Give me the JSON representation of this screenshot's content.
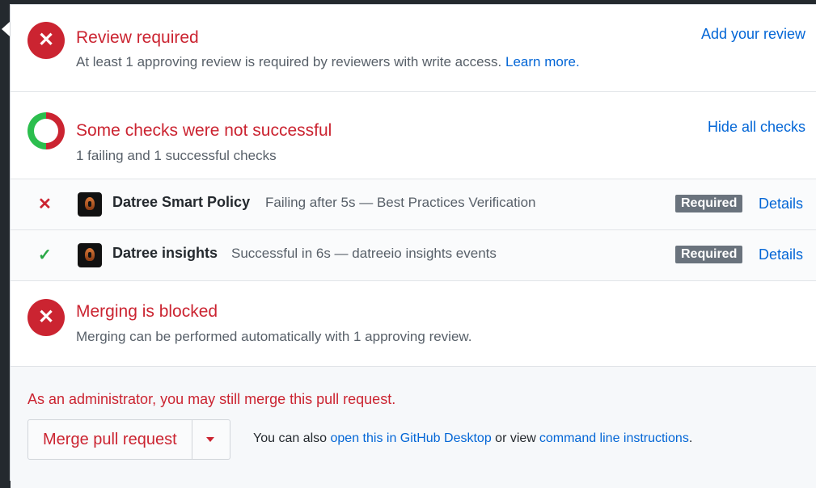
{
  "review": {
    "icon": "x-icon",
    "title": "Review required",
    "description": "At least 1 approving review is required by reviewers with write access.",
    "learn_more": "Learn more.",
    "action": "Add your review"
  },
  "checks": {
    "title": "Some checks were not successful",
    "description": "1 failing and 1 successful checks",
    "action": "Hide all checks",
    "items": [
      {
        "state_icon": "x-icon",
        "name": "Datree Smart Policy",
        "status": "Failing after 5s — Best Practices Verification",
        "badge": "Required",
        "details": "Details"
      },
      {
        "state_icon": "check-icon",
        "name": "Datree insights",
        "status": "Successful in 6s — datreeio insights events",
        "badge": "Required",
        "details": "Details"
      }
    ]
  },
  "merge": {
    "icon": "x-icon",
    "title": "Merging is blocked",
    "description": "Merging can be performed automatically with 1 approving review."
  },
  "admin": {
    "note": "As an administrator, you may still merge this pull request.",
    "button_label": "Merge pull request",
    "alt_prefix": "You can also",
    "desktop_link": "open this in GitHub Desktop",
    "alt_middle": "or view",
    "cli_link": "command line instructions",
    "alt_suffix": "."
  },
  "colors": {
    "error": "#cb2431",
    "success": "#2cbe4e",
    "link": "#0366d6",
    "badge": "#6a737d"
  }
}
